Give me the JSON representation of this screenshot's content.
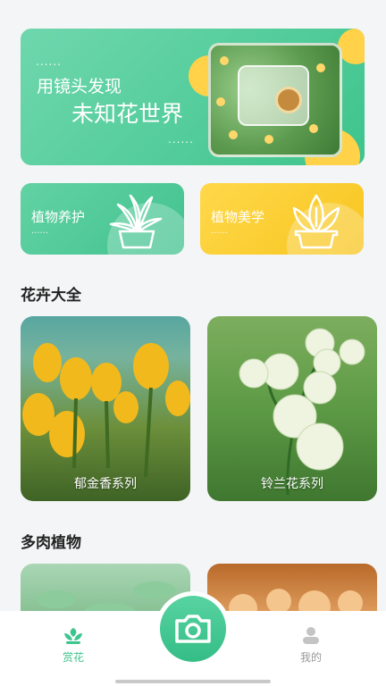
{
  "banner": {
    "line1": "用镜头发现",
    "line2": "未知花世界",
    "dots": "......"
  },
  "cards": {
    "care_label": "植物养护",
    "beauty_label": "植物美学",
    "dots": "......"
  },
  "sections": {
    "flowers_title": "花卉大全",
    "succulents_title": "多肉植物"
  },
  "flowers": [
    {
      "name": "郁金香系列"
    },
    {
      "name": "铃兰花系列"
    }
  ],
  "tabbar": {
    "home_label": "赏花",
    "mine_label": "我的"
  },
  "colors": {
    "accent": "#3ec48d",
    "yellow": "#ffd24a",
    "inactive": "#999999"
  },
  "icons": {
    "care": "potted-plant-icon",
    "beauty": "potted-plant-icon",
    "home": "plant-sprout-icon",
    "camera": "camera-icon",
    "mine": "user-icon"
  }
}
